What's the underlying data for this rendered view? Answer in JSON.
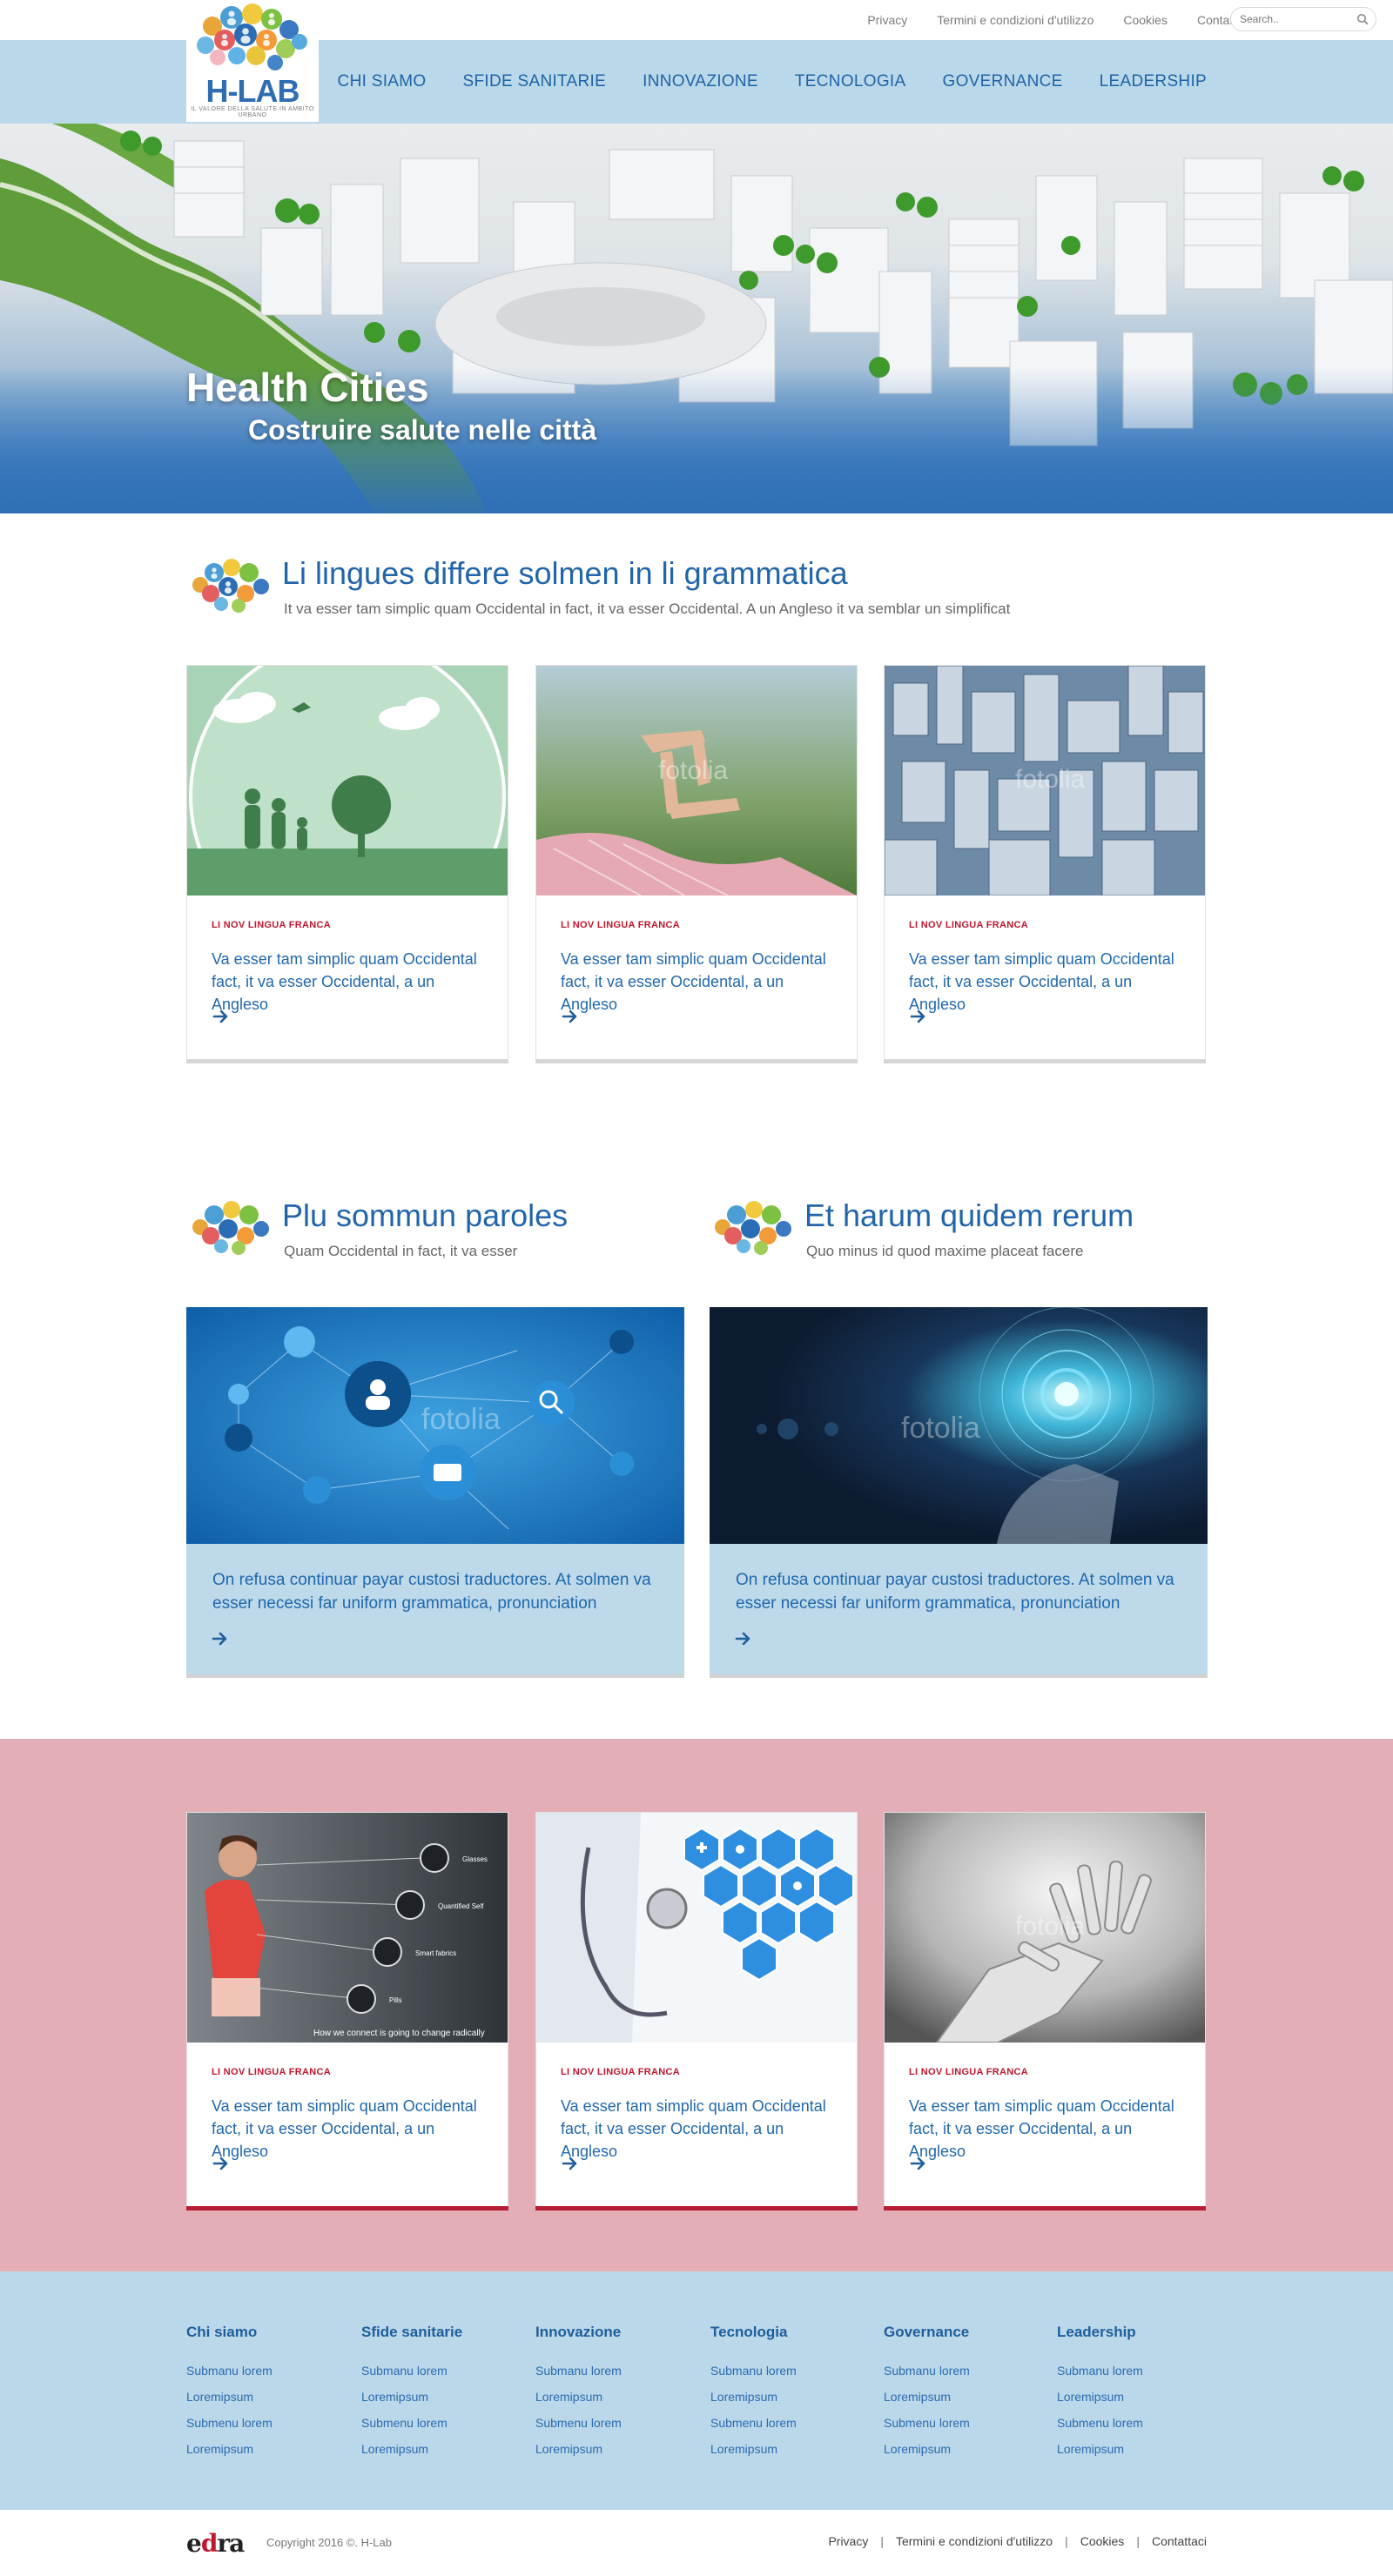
{
  "header": {
    "logo_text": "H-LAB",
    "logo_sub": "IL VALORE DELLA SALUTE IN AMBITO URBANO",
    "top_links": [
      "Privacy",
      "Termini e condizioni d'utilizzo",
      "Cookies",
      "Contattaci"
    ],
    "search_placeholder": "Search..",
    "nav": [
      "CHI SIAMO",
      "SFIDE SANITARIE",
      "INNOVAZIONE",
      "TECNOLOGIA",
      "GOVERNANCE",
      "LEADERSHIP"
    ]
  },
  "hero": {
    "title": "Health Cities",
    "subtitle": "Costruire salute nelle città"
  },
  "section1": {
    "title": "Li lingues differe solmen in li grammatica",
    "subtitle": "It va esser tam simplic quam Occidental in fact, it va esser Occidental. A un Angleso it va semblar un simplificat",
    "cards": [
      {
        "tag": "LI NOV LINGUA FRANCA",
        "text": "Va esser tam simplic quam Occidental fact, it va esser Occidental, a un Angleso"
      },
      {
        "tag": "LI NOV LINGUA FRANCA",
        "text": "Va esser tam simplic quam Occidental fact, it va esser Occidental, a un Angleso"
      },
      {
        "tag": "LI NOV LINGUA FRANCA",
        "text": "Va esser tam simplic quam Occidental fact, it va esser Occidental, a un Angleso"
      }
    ]
  },
  "section2": {
    "left": {
      "title": "Plu sommun paroles",
      "subtitle": "Quam Occidental in fact, it va esser",
      "text": "On refusa continuar payar custosi traductores. At solmen va esser necessi far uniform grammatica, pronunciation"
    },
    "right": {
      "title": "Et harum quidem rerum",
      "subtitle": "Quo minus id quod maxime placeat facere",
      "text": "On refusa continuar payar custosi traductores. At solmen va esser necessi far uniform grammatica, pronunciation"
    }
  },
  "section3": {
    "image_caption": "How we connect is going to change radically",
    "image_labels": [
      "Glasses",
      "Quantified Self",
      "Smart fabrics",
      "Pills"
    ],
    "cards": [
      {
        "tag": "LI NOV LINGUA FRANCA",
        "text": "Va esser tam simplic quam Occidental fact, it va esser Occidental, a un Angleso"
      },
      {
        "tag": "LI NOV LINGUA FRANCA",
        "text": "Va esser tam simplic quam Occidental fact, it va esser Occidental, a un Angleso"
      },
      {
        "tag": "LI NOV LINGUA FRANCA",
        "text": "Va esser tam simplic quam Occidental fact, it va esser Occidental, a un Angleso"
      }
    ]
  },
  "footer": {
    "columns": [
      {
        "title": "Chi siamo",
        "links": [
          "Submanu lorem",
          "Loremipsum",
          "Submenu lorem",
          "Loremipsum"
        ]
      },
      {
        "title": "Sfide sanitarie",
        "links": [
          "Submanu lorem",
          "Loremipsum",
          "Submenu lorem",
          "Loremipsum"
        ]
      },
      {
        "title": "Innovazione",
        "links": [
          "Submanu lorem",
          "Loremipsum",
          "Submenu lorem",
          "Loremipsum"
        ]
      },
      {
        "title": "Tecnologia",
        "links": [
          "Submanu lorem",
          "Loremipsum",
          "Submenu lorem",
          "Loremipsum"
        ]
      },
      {
        "title": "Governance",
        "links": [
          "Submanu lorem",
          "Loremipsum",
          "Submenu lorem",
          "Loremipsum"
        ]
      },
      {
        "title": "Leadership",
        "links": [
          "Submanu lorem",
          "Loremipsum",
          "Submenu lorem",
          "Loremipsum"
        ]
      }
    ],
    "brand_prefix": "e",
    "brand_mark": "d",
    "brand_suffix": "ra",
    "copyright": "Copyright 2016 ©. H-Lab",
    "bottom_links": [
      "Privacy",
      "Termini e condizioni d'utilizzo",
      "Cookies",
      "Contattaci"
    ]
  },
  "colors": {
    "nav_bg": "#b9d8e9",
    "brand_blue": "#2265a9",
    "tag_red": "#c0172e",
    "pink_band": "#e4aeb7",
    "footer_bg": "#bad8ea"
  },
  "icons": [
    "search-icon",
    "arrow-right-icon",
    "bubble-people-icon"
  ]
}
